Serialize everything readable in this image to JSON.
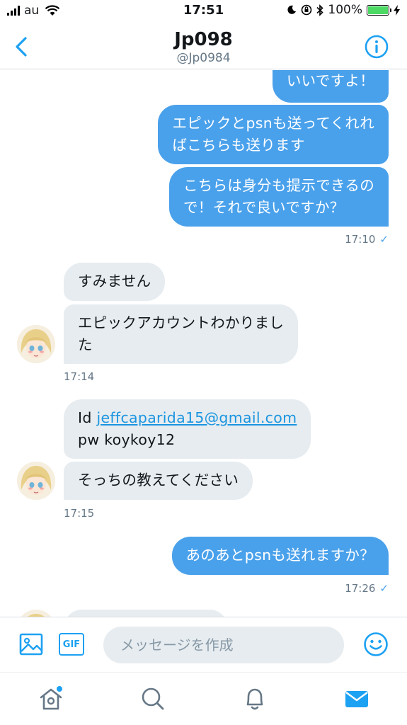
{
  "status_bar": {
    "carrier": "au",
    "time": "17:51",
    "battery": "100%",
    "battery_level": 1.0
  },
  "header": {
    "title": "Jp098",
    "handle": "@Jp0984",
    "back_icon": "chevron-left-icon",
    "info_icon": "info-circle-icon"
  },
  "messages": [
    {
      "id": "m1",
      "side": "sent",
      "lines": [
        "いいですよ！"
      ]
    },
    {
      "id": "m2",
      "side": "sent",
      "lines": [
        "エピックとpsnも送ってくれれ",
        "ばこちらも送ります"
      ]
    },
    {
      "id": "m3",
      "side": "sent",
      "lines": [
        "こちらは身分も提示できるの",
        "で！それで良いですか？"
      ]
    },
    {
      "id": "t1",
      "type": "time",
      "text": "17:10",
      "read": true
    },
    {
      "id": "m4",
      "side": "recv",
      "lines": [
        "すみません"
      ]
    },
    {
      "id": "m5",
      "side": "recv",
      "lines": [
        "エピックアカウントわかりまし",
        "た"
      ]
    },
    {
      "id": "t2",
      "type": "time",
      "text": "17:14"
    },
    {
      "id": "m6",
      "side": "recv",
      "id_label": "Id",
      "id_link": "jeffcaparida15@gmail.com",
      "pw_line": "pw koykoy12"
    },
    {
      "id": "m7",
      "side": "recv",
      "lines": [
        "そっちの教えてください"
      ]
    },
    {
      "id": "t3",
      "type": "time",
      "text": "17:15"
    },
    {
      "id": "m8",
      "side": "sent",
      "lines": [
        "あのあとpsnも送れますか？"
      ]
    },
    {
      "id": "t4",
      "type": "time",
      "text": "17:26",
      "read": true
    }
  ],
  "composer": {
    "placeholder": "メッセージを作成",
    "gif_label": "GIF",
    "media_icon": "image-icon",
    "emoji_icon": "smiley-icon"
  },
  "tabbar": {
    "items": [
      "home-icon",
      "search-icon",
      "notifications-icon",
      "messages-icon"
    ],
    "active": "messages-icon",
    "home_has_badge": true
  },
  "colors": {
    "accent": "#1da1f2",
    "sent_bubble": "#4aa1eb",
    "recv_bubble": "#e6ecf0"
  }
}
